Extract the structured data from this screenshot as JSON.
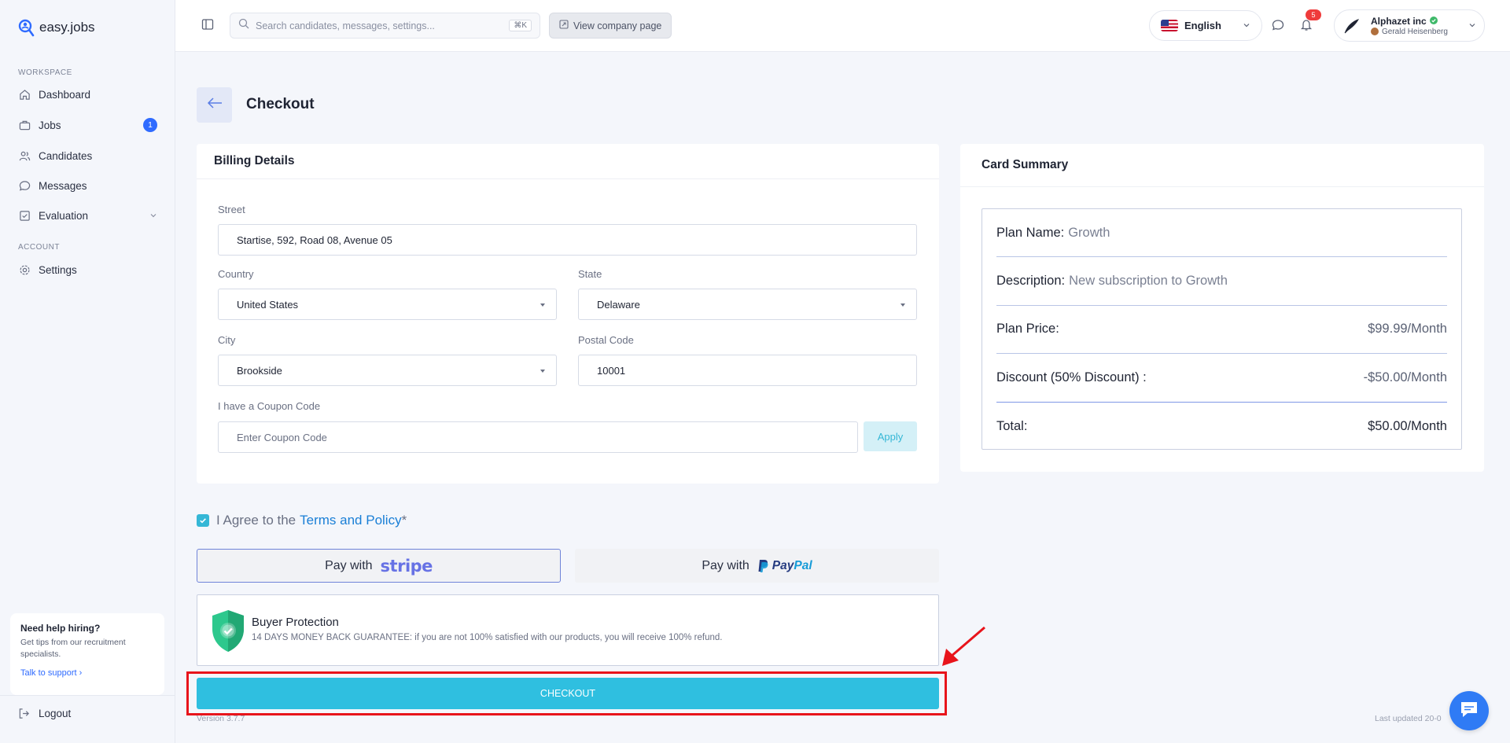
{
  "app": {
    "name": "easy.jobs"
  },
  "sidebar": {
    "workspace_label": "WORKSPACE",
    "account_label": "ACCOUNT",
    "items": [
      {
        "label": "Dashboard"
      },
      {
        "label": "Jobs",
        "badge": "1"
      },
      {
        "label": "Candidates"
      },
      {
        "label": "Messages"
      },
      {
        "label": "Evaluation"
      },
      {
        "label": "Settings"
      }
    ],
    "help": {
      "title": "Need help hiring?",
      "text": "Get tips from our recruitment specialists.",
      "link": "Talk to support"
    },
    "logout": "Logout"
  },
  "topbar": {
    "search_placeholder": "Search candidates, messages, settings...",
    "shortcut": "⌘K",
    "view_company": "View company page",
    "language": "English",
    "notification_count": "5",
    "company_name": "Alphazet inc",
    "user_name": "Gerald Heisenberg"
  },
  "page": {
    "title": "Checkout"
  },
  "billing": {
    "title": "Billing Details",
    "street_label": "Street",
    "street_value": "Startise, 592, Road 08, Avenue 05",
    "country_label": "Country",
    "country_value": "United States",
    "state_label": "State",
    "state_value": "Delaware",
    "city_label": "City",
    "city_value": "Brookside",
    "postal_label": "Postal Code",
    "postal_value": "10001",
    "coupon_label": "I have a Coupon Code",
    "coupon_placeholder": "Enter Coupon Code",
    "apply_label": "Apply"
  },
  "summary": {
    "title": "Card Summary",
    "plan_name_label": "Plan Name:",
    "plan_name_value": "Growth",
    "description_label": "Description:",
    "description_value": "New subscription to Growth",
    "plan_price_label": "Plan Price:",
    "plan_price_value": "$99.99/Month",
    "discount_label": "Discount (50% Discount) :",
    "discount_value": "-$50.00/Month",
    "total_label": "Total:",
    "total_value": "$50.00/Month"
  },
  "agreement": {
    "text": "I Agree to the",
    "link": "Terms and Policy",
    "asterisk": "*",
    "checked": true
  },
  "payment": {
    "stripe_prefix": "Pay with",
    "stripe_brand": "stripe",
    "paypal_prefix": "Pay with",
    "paypal_brand_pay": "Pay",
    "paypal_brand_pal": "Pal"
  },
  "buyer_protection": {
    "title": "Buyer Protection",
    "text": "14 DAYS MONEY BACK GUARANTEE: if you are not 100% satisfied with our products, you will receive 100% refund."
  },
  "checkout_label": "CHECKOUT",
  "footer": {
    "version": "Version 3.7.7",
    "last_updated": "Last updated 20-0"
  },
  "colors": {
    "accent": "#2fbfe0",
    "primary_blue": "#2f6bff",
    "annotation_red": "#e8141b"
  }
}
